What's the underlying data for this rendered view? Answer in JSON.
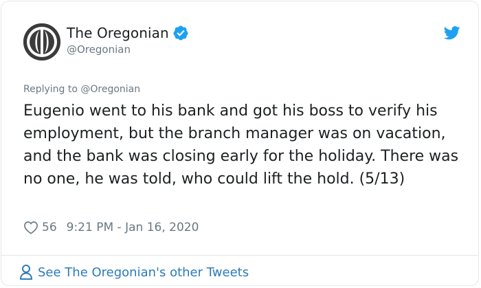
{
  "author": {
    "display_name": "The Oregonian",
    "handle": "@Oregonian",
    "avatar_icon": "oregonian-logo-icon",
    "verified_icon": "verified-badge-icon"
  },
  "brand": {
    "icon": "twitter-bird-icon",
    "accent_color": "#1da1f2",
    "link_color": "#2b7bb9",
    "muted_color": "#697882"
  },
  "tweet": {
    "replying_to": "Replying to @Oregonian",
    "text": "Eugenio went to his bank and got his boss to verify his employment, but the branch manager was on vacation, and the bank was closing early for the holiday. There was no one, he was told, who could lift the hold. (5/13)",
    "like_icon": "heart-icon",
    "like_count": "56",
    "timestamp": "9:21 PM - Jan 16, 2020"
  },
  "footer": {
    "icon": "person-icon",
    "link_text": "See The Oregonian's other Tweets"
  }
}
